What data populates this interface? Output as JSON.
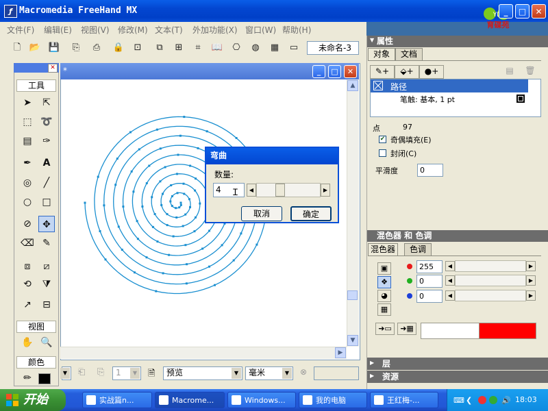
{
  "window": {
    "title": "Macromedia FreeHand MX",
    "min_label": "_",
    "max_label": "□",
    "close_label": "✕",
    "brand": "育碟苑"
  },
  "menu": [
    "文件(F)",
    "编辑(E)",
    "视图(V)",
    "修改(M)",
    "文本(T)",
    "外加功能(X)",
    "窗口(W)",
    "帮助(H)"
  ],
  "toolbar": {
    "doc_select": "未命名-3"
  },
  "tools_panel": {
    "header": "工具",
    "view_header": "视图",
    "color_header": "颜色"
  },
  "document": {
    "title_suffix": "*",
    "spiral_color": "#1a8fd0"
  },
  "dialog": {
    "title": "弯曲",
    "amount_label": "数量:",
    "amount_value": "4",
    "cancel": "取消",
    "ok": "确定"
  },
  "properties": {
    "header": "属性",
    "tabs": [
      "对象",
      "文档"
    ],
    "path_label": "路径",
    "stroke_label": "笔触: 基本, 1 pt",
    "points_label": "点",
    "points_value": "97",
    "even_odd_label": "奇偶填充(E)",
    "even_odd_checked": true,
    "closed_label": "封闭(C)",
    "closed_checked": false,
    "smoothness_label": "平滑度",
    "smoothness_value": "0"
  },
  "mixer": {
    "header": "混色器 和 色调",
    "tabs": [
      "混色器",
      "色调"
    ],
    "r": "255",
    "g": "0",
    "b": "0",
    "current_color": "#ff0000"
  },
  "collapsed_panels": [
    "层",
    "资源"
  ],
  "statusbar": {
    "view_mode": "预览",
    "units": "毫米"
  },
  "taskbar": {
    "start": "开始",
    "tasks": [
      "实战篇n...",
      "Macrome...",
      "Windows...",
      "我的电脑",
      "王红梅-..."
    ],
    "clock": "18:03"
  }
}
